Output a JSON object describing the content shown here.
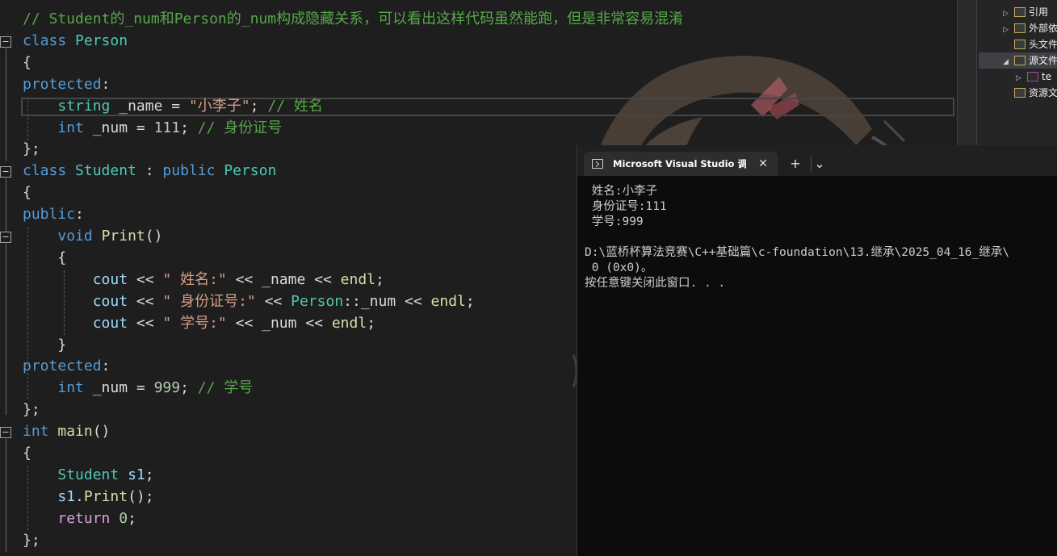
{
  "editor": {
    "lines": [
      [
        [
          "cmt",
          "// Student的_num和Person的_num构成隐藏关系，可以看出这样代码虽然能跑，但是非常容易混淆"
        ]
      ],
      [
        [
          "kw",
          "class"
        ],
        [
          "id",
          " "
        ],
        [
          "type",
          "Person"
        ]
      ],
      [
        [
          "id",
          "{"
        ]
      ],
      [
        [
          "kw",
          "protected"
        ],
        [
          "id",
          ":"
        ]
      ],
      [
        [
          "id",
          "    "
        ],
        [
          "type",
          "string"
        ],
        [
          "id",
          " _name = "
        ],
        [
          "str",
          "\"小李子\""
        ],
        [
          "id",
          "; "
        ],
        [
          "cmt",
          "// 姓名"
        ]
      ],
      [
        [
          "id",
          "    "
        ],
        [
          "kw",
          "int"
        ],
        [
          "id",
          " _num = "
        ],
        [
          "num",
          "111"
        ],
        [
          "id",
          "; "
        ],
        [
          "cmt",
          "// 身份证号"
        ]
      ],
      [
        [
          "id",
          "};"
        ]
      ],
      [
        [
          "kw",
          "class"
        ],
        [
          "id",
          " "
        ],
        [
          "type",
          "Student"
        ],
        [
          "id",
          " : "
        ],
        [
          "kw",
          "public"
        ],
        [
          "id",
          " "
        ],
        [
          "type",
          "Person"
        ]
      ],
      [
        [
          "id",
          "{"
        ]
      ],
      [
        [
          "kw",
          "public"
        ],
        [
          "id",
          ":"
        ]
      ],
      [
        [
          "id",
          "    "
        ],
        [
          "kw",
          "void"
        ],
        [
          "id",
          " "
        ],
        [
          "fn",
          "Print"
        ],
        [
          "id",
          "()"
        ]
      ],
      [
        [
          "id",
          "    {"
        ]
      ],
      [
        [
          "id",
          "        "
        ],
        [
          "var",
          "cout"
        ],
        [
          "id",
          " << "
        ],
        [
          "str",
          "\" 姓名:\""
        ],
        [
          "id",
          " << _name << "
        ],
        [
          "fn",
          "endl"
        ],
        [
          "id",
          ";"
        ]
      ],
      [
        [
          "id",
          "        "
        ],
        [
          "var",
          "cout"
        ],
        [
          "id",
          " << "
        ],
        [
          "str",
          "\" 身份证号:\""
        ],
        [
          "id",
          " << "
        ],
        [
          "type",
          "Person"
        ],
        [
          "id",
          "::_num << "
        ],
        [
          "fn",
          "endl"
        ],
        [
          "id",
          ";"
        ]
      ],
      [
        [
          "id",
          "        "
        ],
        [
          "var",
          "cout"
        ],
        [
          "id",
          " << "
        ],
        [
          "str",
          "\" 学号:\""
        ],
        [
          "id",
          " << _num << "
        ],
        [
          "fn",
          "endl"
        ],
        [
          "id",
          ";"
        ]
      ],
      [
        [
          "id",
          "    }"
        ]
      ],
      [
        [
          "kw",
          "protected"
        ],
        [
          "id",
          ":"
        ]
      ],
      [
        [
          "id",
          "    "
        ],
        [
          "kw",
          "int"
        ],
        [
          "id",
          " _num = "
        ],
        [
          "num",
          "999"
        ],
        [
          "id",
          "; "
        ],
        [
          "cmt",
          "// 学号"
        ]
      ],
      [
        [
          "id",
          "};"
        ]
      ],
      [
        [
          "kw",
          "int"
        ],
        [
          "id",
          " "
        ],
        [
          "fn",
          "main"
        ],
        [
          "id",
          "()"
        ]
      ],
      [
        [
          "id",
          "{"
        ]
      ],
      [
        [
          "id",
          "    "
        ],
        [
          "type",
          "Student"
        ],
        [
          "id",
          " "
        ],
        [
          "var",
          "s1"
        ],
        [
          "id",
          ";"
        ]
      ],
      [
        [
          "id",
          "    "
        ],
        [
          "var",
          "s1"
        ],
        [
          "id",
          "."
        ],
        [
          "fn",
          "Print"
        ],
        [
          "id",
          "();"
        ]
      ],
      [
        [
          "id",
          "    "
        ],
        [
          "ctl",
          "return"
        ],
        [
          "id",
          " "
        ],
        [
          "num",
          "0"
        ],
        [
          "id",
          ";"
        ]
      ],
      [
        [
          "id",
          "};"
        ]
      ]
    ],
    "fold_glyph": "−"
  },
  "explorer": {
    "items": [
      {
        "label": "引用",
        "arrow": "▷",
        "icon": "references-icon"
      },
      {
        "label": "外部依",
        "arrow": "▷",
        "icon": "external-deps-icon"
      },
      {
        "label": "头文件",
        "arrow": "",
        "icon": "folder-icon"
      },
      {
        "label": "源文件",
        "arrow": "◢",
        "icon": "folder-icon"
      },
      {
        "label": "te",
        "arrow": "▷",
        "icon": "cpp-file-icon"
      },
      {
        "label": "资源文",
        "arrow": "",
        "icon": "folder-icon"
      }
    ]
  },
  "console": {
    "tab_title": "Microsoft Visual Studio 调试控",
    "close_glyph": "✕",
    "new_tab_glyph": "+",
    "dropdown_glyph": "⌄",
    "output": [
      " 姓名:小李子",
      " 身份证号:111",
      " 学号:999",
      "",
      "D:\\蓝桥杯算法竞赛\\C++基础篇\\c-foundation\\13.继承\\2025_04_16_继承\\",
      " 0 (0x0)。",
      "按任意键关闭此窗口. . ."
    ]
  },
  "colors": {
    "keyword": "#569cd6",
    "type": "#4ec9b0",
    "function": "#dcdcaa",
    "string": "#d69d85",
    "comment": "#57a64a",
    "number": "#b5cea8"
  }
}
